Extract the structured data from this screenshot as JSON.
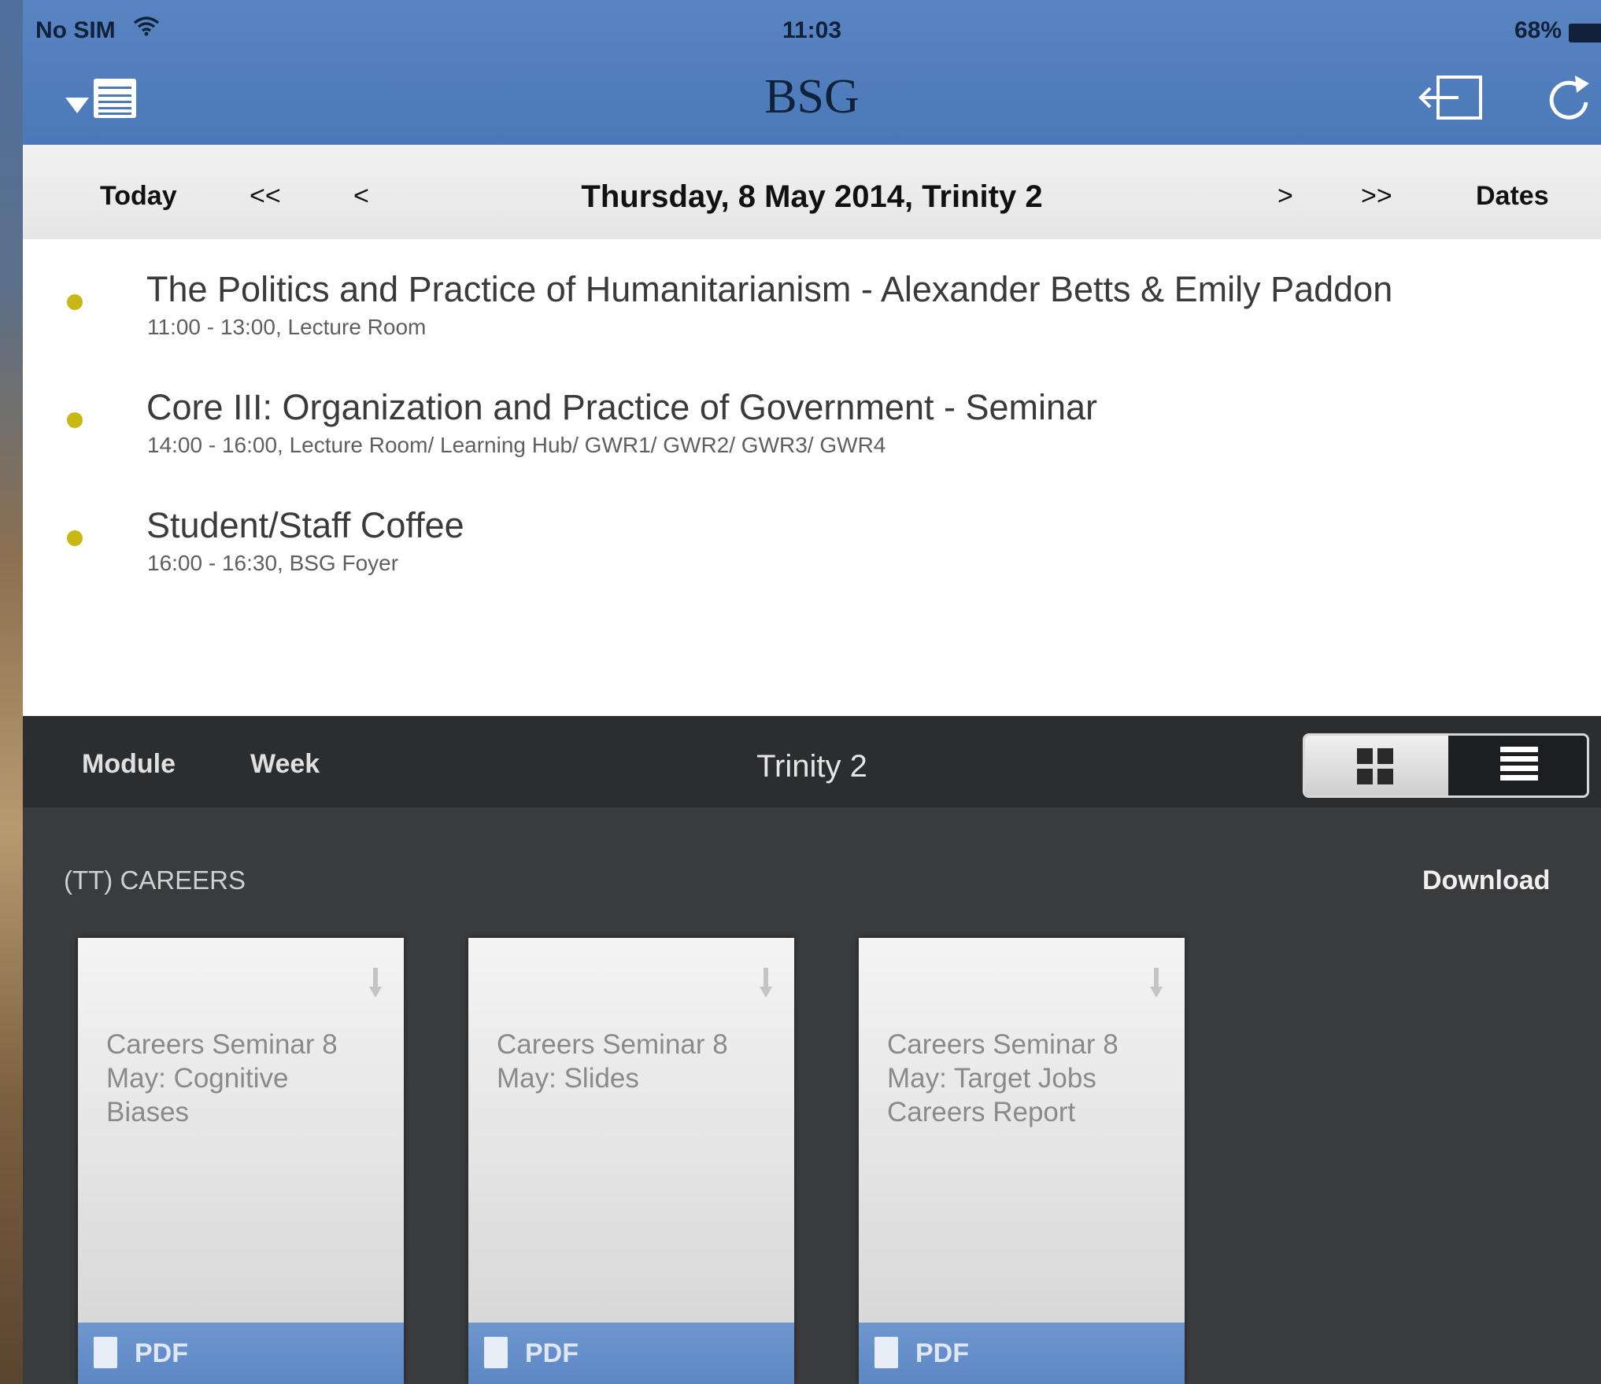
{
  "status_bar": {
    "carrier": "No SIM",
    "time": "11:03",
    "battery": "68%"
  },
  "nav": {
    "title": "BSG",
    "menu_icon": "menu-document-icon",
    "logout_icon": "logout-icon",
    "refresh_icon": "refresh-icon"
  },
  "date_nav": {
    "today": "Today",
    "prev_week": "<<",
    "prev_day": "<",
    "current_date": "Thursday, 8 May 2014, Trinity 2",
    "next_day": ">",
    "next_week": ">>",
    "dates": "Dates"
  },
  "events": [
    {
      "title": "The Politics and Practice of Humanitarianism - Alexander Betts & Emily Paddon",
      "detail": "11:00 - 13:00,  Lecture Room"
    },
    {
      "title": "Core III: Organization and Practice of Government - Seminar",
      "detail": "14:00 - 16:00,  Lecture Room/ Learning Hub/ GWR1/ GWR2/ GWR3/ GWR4"
    },
    {
      "title": "Student/Staff Coffee",
      "detail": "16:00 - 16:30,  BSG Foyer"
    }
  ],
  "lower_panel": {
    "tabs": {
      "module": "Module",
      "week": "Week"
    },
    "title": "Trinity 2",
    "section_label": "(TT) CAREERS",
    "download": "Download",
    "documents": [
      {
        "title": "Careers Seminar 8 May: Cognitive Biases",
        "type": "PDF"
      },
      {
        "title": "Careers Seminar 8 May: Slides",
        "type": "PDF"
      },
      {
        "title": "Careers Seminar 8 May: Target Jobs Careers Report",
        "type": "PDF"
      }
    ]
  },
  "colors": {
    "nav_blue": "#4a78b8",
    "event_dot": "#c8b814",
    "dark_panel": "#3a3b3d",
    "card_footer": "#5c87c3"
  }
}
